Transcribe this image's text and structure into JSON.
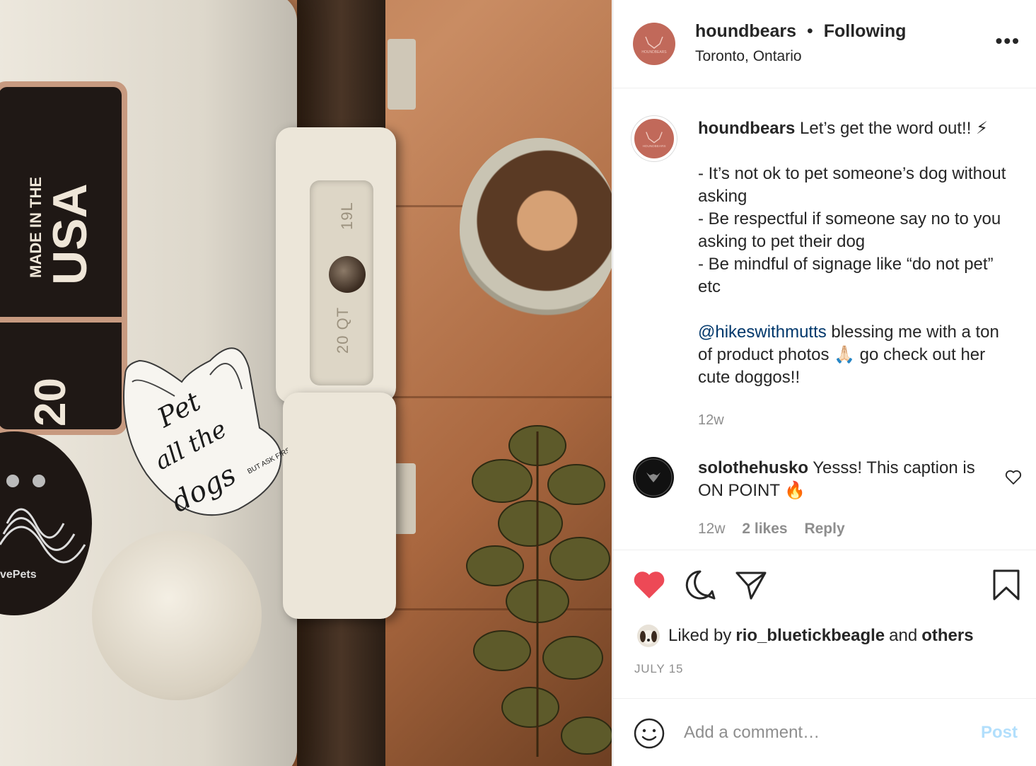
{
  "photo": {
    "badge_line1": "MADE IN THE",
    "badge_line2": "USA",
    "badge_number": "20",
    "handle_capacity_top": "19L",
    "handle_capacity_bottom": "20 QT",
    "round_sticker_text": "vePets",
    "dog_sticker_main": "Pet all the dogs",
    "dog_sticker_sub": "BUT ASK FIRST"
  },
  "header": {
    "username": "houndbears",
    "separator": "•",
    "follow_status": "Following",
    "location": "Toronto, Ontario",
    "more_icon": "more-horizontal-icon",
    "avatar_label": "HOUNDBEARS"
  },
  "caption": {
    "username": "houndbears",
    "intro": "Let’s get the word out!! ⚡",
    "body": "- It’s not ok to pet someone’s dog without asking\n- Be respectful if someone say no to you asking to pet their dog\n- Be mindful of signage like “do not pet” etc",
    "mention": "@hikeswithmutts",
    "closing": " blessing me with a ton of product photos 🙏🏻 go check out her cute doggos!!",
    "time": "12w"
  },
  "comment": {
    "username": "solothehusko",
    "text": "Yesss! This caption is ON POINT 🔥",
    "time": "12w",
    "likes": "2 likes",
    "reply_label": "Reply"
  },
  "actions": {
    "liked_prefix": "Liked by",
    "liked_user": "rio_bluetickbeagle",
    "liked_and": "and",
    "liked_others": "others",
    "date": "JULY 15"
  },
  "add_comment": {
    "placeholder": "Add a comment…",
    "post_label": "Post"
  },
  "colors": {
    "like_red": "#ed4956",
    "post_disabled": "#b2dffc",
    "mention_blue": "#00376b",
    "avatar_brand": "#c1695a"
  }
}
